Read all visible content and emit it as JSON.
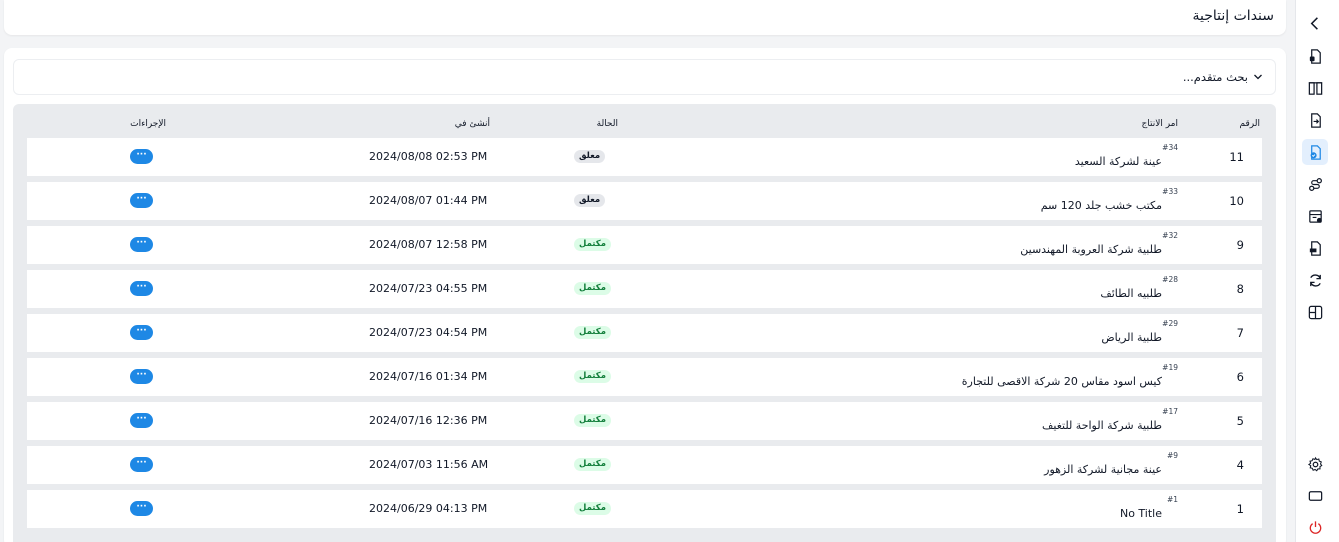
{
  "page": {
    "title": "سندات إنتاجية"
  },
  "search": {
    "label": "بحث متقدم..."
  },
  "table": {
    "headers": {
      "number": "الرقم",
      "order": "امر الانتاج",
      "status": "الحالة",
      "created": "أنشئ في",
      "actions": "الإجراءات"
    },
    "action_label": "···",
    "rows": [
      {
        "num": "11",
        "order_id": "#34",
        "order_name": "عينة لشركة السعيد",
        "status": "معلق",
        "status_type": "hold",
        "created": "2024/08/08 02:53 PM"
      },
      {
        "num": "10",
        "order_id": "#33",
        "order_name": "مكتب خشب جلد 120 سم",
        "status": "معلق",
        "status_type": "hold",
        "created": "2024/08/07 01:44 PM"
      },
      {
        "num": "9",
        "order_id": "#32",
        "order_name": "طلبية شركة العروبة المهندسين",
        "status": "مكتمل",
        "status_type": "done",
        "created": "2024/08/07 12:58 PM"
      },
      {
        "num": "8",
        "order_id": "#28",
        "order_name": "طلبيه الطائف",
        "status": "مكتمل",
        "status_type": "done",
        "created": "2024/07/23 04:55 PM"
      },
      {
        "num": "7",
        "order_id": "#29",
        "order_name": "طلبية الرياض",
        "status": "مكتمل",
        "status_type": "done",
        "created": "2024/07/23 04:54 PM"
      },
      {
        "num": "6",
        "order_id": "#19",
        "order_name": "كيس اسود مقاس 20 شركة الاقصى للتجارة",
        "status": "مكتمل",
        "status_type": "done",
        "created": "2024/07/16 01:34 PM"
      },
      {
        "num": "5",
        "order_id": "#17",
        "order_name": "طلبية شركة الواحة للتغيف",
        "status": "مكتمل",
        "status_type": "done",
        "created": "2024/07/16 12:36 PM"
      },
      {
        "num": "4",
        "order_id": "#9",
        "order_name": "عينة مجانية لشركة الزهور",
        "status": "مكتمل",
        "status_type": "done",
        "created": "2024/07/03 11:56 AM"
      },
      {
        "num": "1",
        "order_id": "#1",
        "order_name": "No Title",
        "status": "مكتمل",
        "status_type": "done",
        "created": "2024/06/29 04:13 PM"
      }
    ]
  },
  "sidebar": {
    "items": [
      {
        "icon": "chevron-left-icon"
      },
      {
        "icon": "file-lock-icon"
      },
      {
        "icon": "columns-icon"
      },
      {
        "icon": "file-transfer-icon"
      },
      {
        "icon": "file-check-icon",
        "active": true
      },
      {
        "icon": "route-icon"
      },
      {
        "icon": "invoice-icon"
      },
      {
        "icon": "file-print-icon"
      },
      {
        "icon": "refresh-icon"
      },
      {
        "icon": "layout-icon"
      },
      {
        "icon": "gear-icon"
      },
      {
        "icon": "monitor-icon"
      },
      {
        "icon": "power-icon"
      }
    ]
  },
  "colors": {
    "accent": "#1e88e5",
    "done_bg": "#dcfce7",
    "done_text": "#15803d",
    "hold_bg": "#e5e7eb",
    "power": "#dc2626"
  }
}
